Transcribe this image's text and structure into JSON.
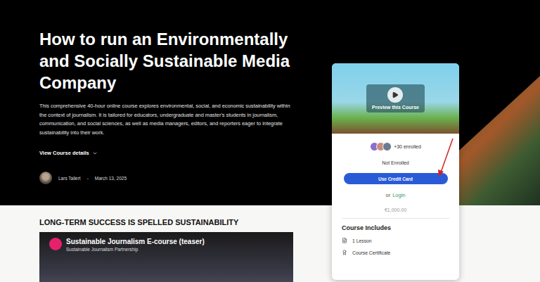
{
  "course": {
    "title": "How to run an Environmentally and Socially Sustainable Media Company",
    "description": "This comprehensive 40-hour online course explores environmental, social, and economic sustainability within the context of journalism. It is tailored for educators, undergraduate and master's students in journalism, communication, and social sciences, as well as media managers, editors, and reporters eager to integrate sustainability into their work.",
    "details_toggle": "View Course details",
    "author": "Lars Tallert",
    "separator": "-",
    "date": "March 13, 2025"
  },
  "card": {
    "preview_label": "Preview this Course",
    "enrolled": "+30 enrolled",
    "status": "Not Enrolled",
    "buy_button": "Use Credit Card",
    "or": "or",
    "login": "Login",
    "price": "€1,000.00",
    "includes_title": "Course Includes",
    "includes": [
      {
        "label": "1 Lesson",
        "kind": "lesson"
      },
      {
        "label": "Course Certificate",
        "kind": "certificate"
      }
    ]
  },
  "section": {
    "heading": "LONG-TERM SUCCESS IS SPELLED SUSTAINABILITY",
    "video": {
      "title": "Sustainable Journalism E-course (teaser)",
      "channel": "Sustainable Journalism Partnership"
    }
  }
}
